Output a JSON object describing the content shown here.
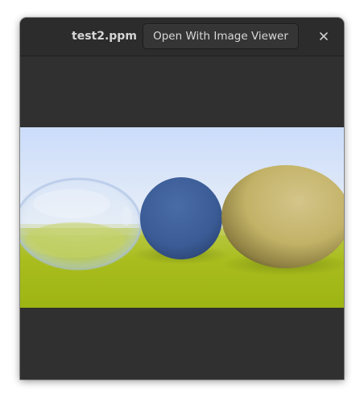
{
  "window": {
    "title": "test2.ppm",
    "open_with_label": "Open With Image Viewer",
    "close_icon": "close-icon"
  },
  "image": {
    "description_icon": "rendered-image",
    "colors": {
      "sky_top": "#cfe0fb",
      "sky_bottom": "#ecf1f6",
      "ground": "#a7bd1a",
      "blue_sphere": "#3b5f9c",
      "gold_sphere": "#c7b667"
    }
  }
}
